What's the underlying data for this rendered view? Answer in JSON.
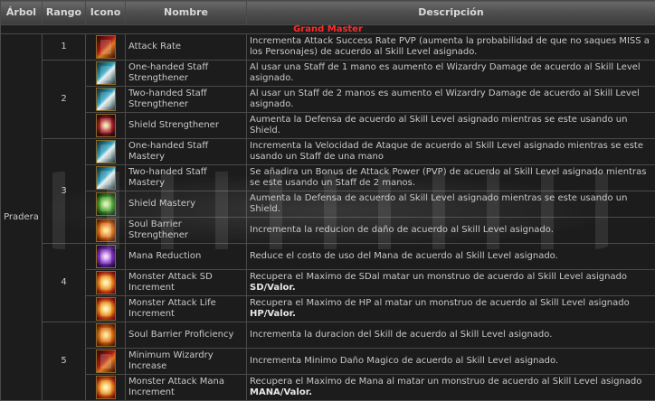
{
  "headers": {
    "tree": "Árbol",
    "rank": "Rango",
    "icon": "Icono",
    "name": "Nombre",
    "desc": "Descripción"
  },
  "section_title": "Grand Master",
  "tree_name": "Pradera",
  "ranks": {
    "r1": "1",
    "r2": "2",
    "r3": "3",
    "r4": "4",
    "r5": "5"
  },
  "skills": [
    {
      "name": "Attack Rate",
      "icon": "attack-rate-icon",
      "desc": "Incrementa Attack Success Rate PVP (aumenta la probabilidad de que no saques MISS a los Personajes) de acuerdo al Skill Level asignado."
    },
    {
      "name": "One-handed Staff Strengthener",
      "icon": "staff-icon",
      "desc": "Al usar una Staff de 1 mano es aumento el Wizardry Damage de acuerdo al Skill Level asignado."
    },
    {
      "name": "Two-handed Staff Strengthener",
      "icon": "staff-icon",
      "desc": "Al usar un Staff de 2 manos es aumento el Wizardry Damage de acuerdo al Skill Level asignado."
    },
    {
      "name": "Shield Strengthener",
      "icon": "shield-icon",
      "desc": "Aumenta la Defensa de acuerdo al Skill Level asignado mientras se este usando un Shield."
    },
    {
      "name": "One-handed Staff Mastery",
      "icon": "staff-icon",
      "desc": "Incrementa la Velocidad de Ataque de acuerdo al Skill Level asignado mientras se este usando un Staff de una mano"
    },
    {
      "name": "Two-handed Staff Mastery",
      "icon": "staff-icon",
      "desc": "Se añadira un Bonus de Attack Power (PVP) de acuerdo al Skill Level asignado mientras se este usando un Staff de 2 manos."
    },
    {
      "name": "Shield Mastery",
      "icon": "shield-mastery-icon",
      "desc": "Aumenta la Defensa de acuerdo al Skill Level asignado mientras se este usando un Shield."
    },
    {
      "name": "Soul Barrier Strengthener",
      "icon": "soul-barrier-icon",
      "desc": "Incrementa la reducion de daño de acuerdo al Skill Level asignado."
    },
    {
      "name": "Mana Reduction",
      "icon": "mana-reduction-icon",
      "desc": "Reduce el costo de uso del Mana de acuerdo al Skill Level asignado."
    },
    {
      "name": "Monster Attack SD Increment",
      "icon": "monster-attack-icon",
      "desc": "Recupera el Maximo de SDal matar un monstruo de acuerdo al Skill Level asignado",
      "unit": "SD/Valor."
    },
    {
      "name": "Monster Attack Life Increment",
      "icon": "monster-attack-icon",
      "desc": "Recupera el Maximo de HP al matar un monstruo de acuerdo al Skill Level asignado",
      "unit": "HP/Valor."
    },
    {
      "name": "Soul Barrier Proficiency",
      "icon": "soul-barrier-icon",
      "desc": "Incrementa la duracion del Skill de acuerdo al Skill Level asignado."
    },
    {
      "name": "Minimum Wizardry Increase",
      "icon": "wizardry-icon",
      "desc": "Incrementa Minimo Daño Magico de acuerdo al Skill Level asignado."
    },
    {
      "name": "Monster Attack Mana Increment",
      "icon": "monster-attack-icon",
      "desc": "Recupera el Maximo de Mana al matar un monstruo de acuerdo al Skill Level asignado",
      "unit": "MANA/Valor."
    }
  ]
}
